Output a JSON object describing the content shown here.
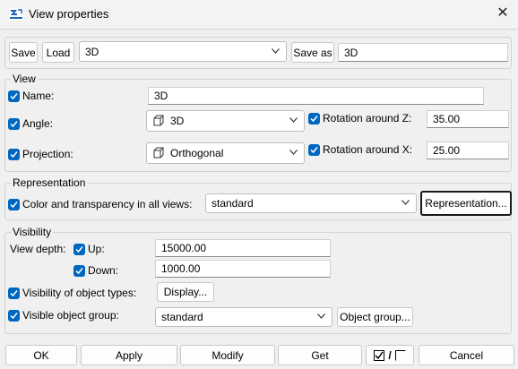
{
  "window": {
    "title": "View properties",
    "icon": "app-icon",
    "close_icon": "close-icon"
  },
  "toolbar": {
    "save_label": "Save",
    "load_label": "Load",
    "preset_value": "3D",
    "save_as_label": "Save as",
    "save_as_value": "3D"
  },
  "view": {
    "title": "View",
    "name_label": "Name:",
    "name_value": "3D",
    "angle_label": "Angle:",
    "angle_value": "3D",
    "rotation_z_label": "Rotation around Z:",
    "rotation_z_value": "35.00",
    "projection_label": "Projection:",
    "projection_value": "Orthogonal",
    "rotation_x_label": "Rotation around X:",
    "rotation_x_value": "25.00"
  },
  "representation": {
    "title": "Representation",
    "color_label": "Color and transparency in all views:",
    "color_value": "standard",
    "button_label": "Representation..."
  },
  "visibility": {
    "title": "Visibility",
    "view_depth_label": "View depth:",
    "up_label": "Up:",
    "up_value": "15000.00",
    "down_label": "Down:",
    "down_value": "1000.00",
    "object_types_label": "Visibility of object types:",
    "display_button": "Display...",
    "object_group_label": "Visible object group:",
    "object_group_value": "standard",
    "object_group_button": "Object group..."
  },
  "footer": {
    "ok": "OK",
    "apply": "Apply",
    "modify": "Modify",
    "get": "Get",
    "toggle_separator": "/",
    "cancel": "Cancel"
  },
  "colors": {
    "checkbox": "#0067c0",
    "focus_border": "#1a1a1a"
  }
}
